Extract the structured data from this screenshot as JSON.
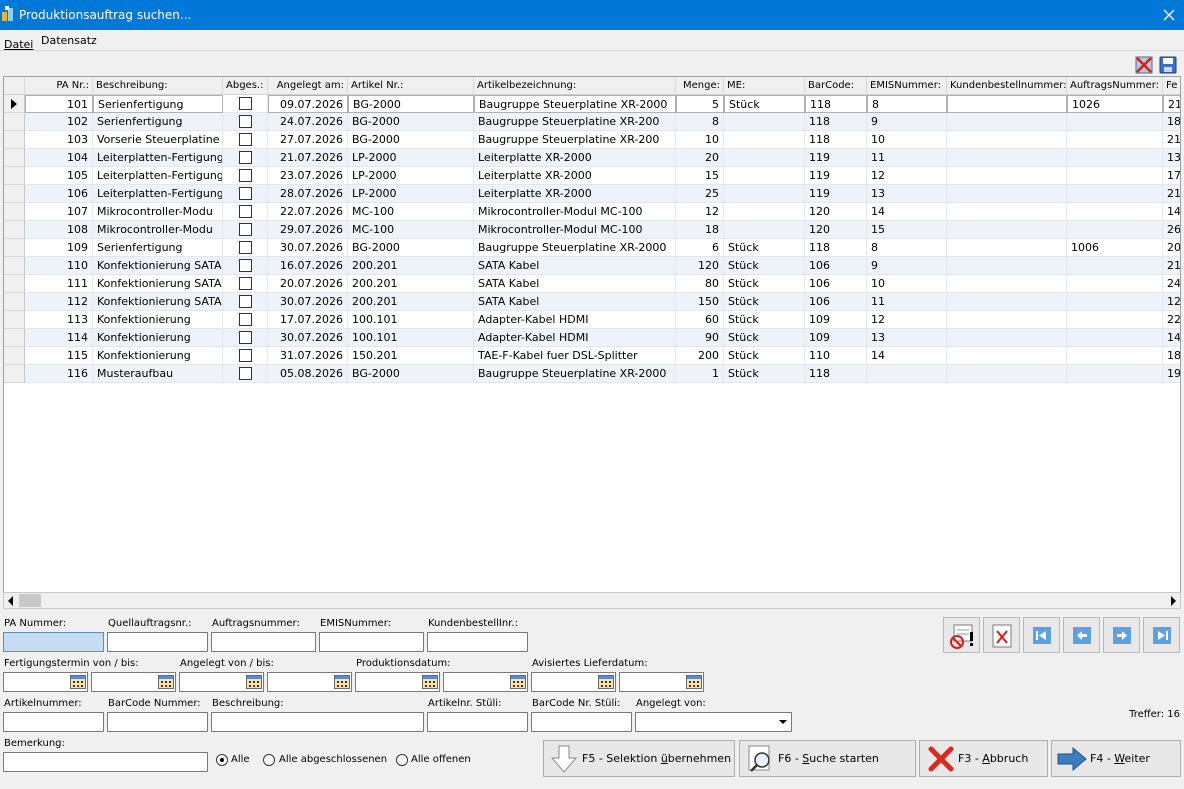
{
  "window": {
    "title": "Produktionsauftrag suchen..."
  },
  "menu": {
    "file": "Datei",
    "record": "Datensatz"
  },
  "grid": {
    "columns": [
      "PA Nr.:",
      "Beschreibung:",
      "Abges.:",
      "Angelegt am:",
      "Artikel Nr.:",
      "Artikelbezeichnung:",
      "Menge:",
      "ME:",
      "BarCode:",
      "EMISNummer:",
      "Kundenbestellnummer:",
      "AuftragsNummer:",
      "Fe"
    ],
    "rows": [
      {
        "pa": "101",
        "desc": "Serienfertigung",
        "date": "09.07.2026",
        "art": "BG-2000",
        "artname": "Baugruppe Steuerplatine XR-2000",
        "qty": "5",
        "me": "Stück",
        "bc": "118",
        "emis": "8",
        "kb": "",
        "an": "1026",
        "fe": "21"
      },
      {
        "pa": "102",
        "desc": "Serienfertigung",
        "date": "24.07.2026",
        "art": "BG-2000",
        "artname": "Baugruppe Steuerplatine XR-200",
        "qty": "8",
        "me": "",
        "bc": "118",
        "emis": "9",
        "kb": "",
        "an": "",
        "fe": "18"
      },
      {
        "pa": "103",
        "desc": "Vorserie Steuerplatine",
        "date": "27.07.2026",
        "art": "BG-2000",
        "artname": "Baugruppe Steuerplatine XR-200",
        "qty": "10",
        "me": "",
        "bc": "118",
        "emis": "10",
        "kb": "",
        "an": "",
        "fe": "21"
      },
      {
        "pa": "104",
        "desc": "Leiterplatten-Fertigung",
        "date": "21.07.2026",
        "art": "LP-2000",
        "artname": "Leiterplatte XR-2000",
        "qty": "20",
        "me": "",
        "bc": "119",
        "emis": "11",
        "kb": "",
        "an": "",
        "fe": "13"
      },
      {
        "pa": "105",
        "desc": "Leiterplatten-Fertigung",
        "date": "23.07.2026",
        "art": "LP-2000",
        "artname": "Leiterplatte XR-2000",
        "qty": "15",
        "me": "",
        "bc": "119",
        "emis": "12",
        "kb": "",
        "an": "",
        "fe": "17"
      },
      {
        "pa": "106",
        "desc": "Leiterplatten-Fertigung",
        "date": "28.07.2026",
        "art": "LP-2000",
        "artname": "Leiterplatte XR-2000",
        "qty": "25",
        "me": "",
        "bc": "119",
        "emis": "13",
        "kb": "",
        "an": "",
        "fe": "21"
      },
      {
        "pa": "107",
        "desc": "Mikrocontroller-Modu",
        "date": "22.07.2026",
        "art": "MC-100",
        "artname": "Mikrocontroller-Modul MC-100",
        "qty": "12",
        "me": "",
        "bc": "120",
        "emis": "14",
        "kb": "",
        "an": "",
        "fe": "14"
      },
      {
        "pa": "108",
        "desc": "Mikrocontroller-Modu",
        "date": "29.07.2026",
        "art": "MC-100",
        "artname": "Mikrocontroller-Modul MC-100",
        "qty": "18",
        "me": "",
        "bc": "120",
        "emis": "15",
        "kb": "",
        "an": "",
        "fe": "26"
      },
      {
        "pa": "109",
        "desc": "Serienfertigung",
        "date": "30.07.2026",
        "art": "BG-2000",
        "artname": "Baugruppe Steuerplatine XR-2000",
        "qty": "6",
        "me": "Stück",
        "bc": "118",
        "emis": "8",
        "kb": "",
        "an": "1006",
        "fe": "20"
      },
      {
        "pa": "110",
        "desc": "Konfektionierung SATA",
        "date": "16.07.2026",
        "art": "200.201",
        "artname": "SATA Kabel",
        "qty": "120",
        "me": "Stück",
        "bc": "106",
        "emis": "9",
        "kb": "",
        "an": "",
        "fe": "21"
      },
      {
        "pa": "111",
        "desc": "Konfektionierung SATA",
        "date": "20.07.2026",
        "art": "200.201",
        "artname": "SATA Kabel",
        "qty": "80",
        "me": "Stück",
        "bc": "106",
        "emis": "10",
        "kb": "",
        "an": "",
        "fe": "24"
      },
      {
        "pa": "112",
        "desc": "Konfektionierung SATA",
        "date": "30.07.2026",
        "art": "200.201",
        "artname": "SATA Kabel",
        "qty": "150",
        "me": "Stück",
        "bc": "106",
        "emis": "11",
        "kb": "",
        "an": "",
        "fe": "12"
      },
      {
        "pa": "113",
        "desc": "Konfektionierung",
        "date": "17.07.2026",
        "art": "100.101",
        "artname": "Adapter-Kabel HDMI",
        "qty": "60",
        "me": "Stück",
        "bc": "109",
        "emis": "12",
        "kb": "",
        "an": "",
        "fe": "22"
      },
      {
        "pa": "114",
        "desc": "Konfektionierung",
        "date": "30.07.2026",
        "art": "100.101",
        "artname": "Adapter-Kabel HDMI",
        "qty": "90",
        "me": "Stück",
        "bc": "109",
        "emis": "13",
        "kb": "",
        "an": "",
        "fe": "14"
      },
      {
        "pa": "115",
        "desc": "Konfektionierung",
        "date": "31.07.2026",
        "art": "150.201",
        "artname": "TAE-F-Kabel fuer DSL-Splitter",
        "qty": "200",
        "me": "Stück",
        "bc": "110",
        "emis": "14",
        "kb": "",
        "an": "",
        "fe": "18"
      },
      {
        "pa": "116",
        "desc": "Musteraufbau",
        "date": "05.08.2026",
        "art": "BG-2000",
        "artname": "Baugruppe Steuerplatine XR-2000",
        "qty": "1",
        "me": "Stück",
        "bc": "118",
        "emis": "",
        "kb": "",
        "an": "",
        "fe": "19"
      }
    ]
  },
  "filters": {
    "pa_nummer": "PA Nummer:",
    "quellauftrag": "Quellauftragsnr.:",
    "auftragsnummer": "Auftragsnummer:",
    "emisnummer": "EMISNummer:",
    "kundenbestell": "KundenbestellInr.:",
    "fertigungstermin": "Fertigungstermin von / bis:",
    "angelegt": "Angelegt von / bis:",
    "produktionsdatum": "Produktionsdatum:",
    "lieferdatum": "Avisiertes Lieferdatum:",
    "artikelnummer": "Artikelnummer:",
    "barcode_nummer": "BarCode Nummer:",
    "beschreibung": "Beschreibung:",
    "artikelnr_stueli": "Artikelnr. Stüli:",
    "barcode_stueli": "BarCode Nr. Stüli:",
    "angelegt_von": "Angelegt von:",
    "bemerkung": "Bemerkung:"
  },
  "radios": {
    "all": "Alle",
    "closed": "Alle abgeschlossenen",
    "open": "Alle offenen"
  },
  "buttons": {
    "f5_prefix": "F5 - Selektion ",
    "f5_u": "ü",
    "f5_suffix": "bernehmen",
    "f6_prefix": "F6 - ",
    "f6_u": "S",
    "f6_suffix": "uche starten",
    "f3_prefix": "F3 - ",
    "f3_u": "A",
    "f3_suffix": "bbruch",
    "f4_prefix": "F4 - ",
    "f4_u": "W",
    "f4_suffix": "eiter"
  },
  "status": {
    "treffer": "Treffer: 16"
  },
  "colors": {
    "titlebar": "#0078d7",
    "row_alt": "#eef2f9"
  }
}
